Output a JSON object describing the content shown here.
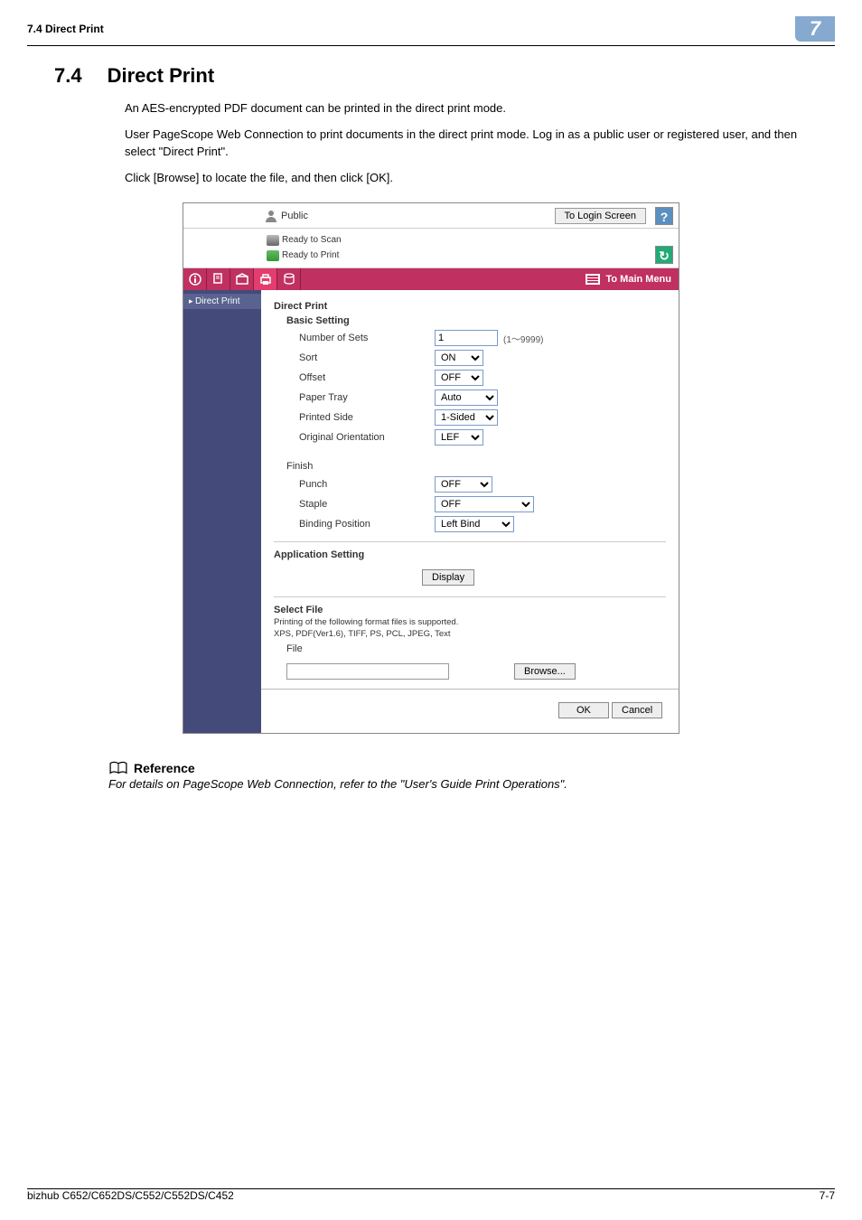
{
  "header": {
    "crumb": "7.4    Direct Print",
    "chapnum": "7"
  },
  "title": {
    "num": "7.4",
    "text": "Direct Print"
  },
  "paras": {
    "p1": "An AES-encrypted PDF document can be printed in the direct print mode.",
    "p2": "User PageScope Web Connection to print documents in the direct print mode. Log in as a public user or registered user, and then select \"Direct Print\".",
    "p3": "Click [Browse] to locate the file, and then click [OK]."
  },
  "ss": {
    "top": {
      "user": "Public",
      "login": "To Login Screen",
      "help": "?"
    },
    "status": {
      "scan": "Ready to Scan",
      "print": "Ready to Print",
      "refresh": "↻"
    },
    "tabs": {
      "tomain": "To Main Menu"
    },
    "side": {
      "item1": "Direct Print"
    },
    "main": {
      "h1": "Direct Print",
      "basic": {
        "title": "Basic Setting",
        "sets_lbl": "Number of Sets",
        "sets_val": "1",
        "sets_hint": "(1～9999)",
        "sort_lbl": "Sort",
        "sort_val": "ON",
        "offset_lbl": "Offset",
        "offset_val": "OFF",
        "tray_lbl": "Paper Tray",
        "tray_val": "Auto",
        "side_lbl": "Printed Side",
        "side_val": "1-Sided",
        "orient_lbl": "Original Orientation",
        "orient_val": "LEF"
      },
      "finish": {
        "title": "Finish",
        "punch_lbl": "Punch",
        "punch_val": "OFF",
        "staple_lbl": "Staple",
        "staple_val": "OFF",
        "bind_lbl": "Binding Position",
        "bind_val": "Left Bind"
      },
      "app": {
        "title": "Application Setting",
        "display_btn": "Display"
      },
      "file": {
        "title": "Select File",
        "note": "Printing of the following format files is supported.\nXPS, PDF(Ver1.6), TIFF, PS, PCL, JPEG, Text",
        "lbl": "File",
        "browse": "Browse..."
      },
      "actions": {
        "ok": "OK",
        "cancel": "Cancel"
      }
    }
  },
  "reference": {
    "head": "Reference",
    "text": "For details on PageScope Web Connection, refer to the \"User's Guide Print Operations\"."
  },
  "footer": {
    "model": "bizhub C652/C652DS/C552/C552DS/C452",
    "page": "7-7"
  }
}
